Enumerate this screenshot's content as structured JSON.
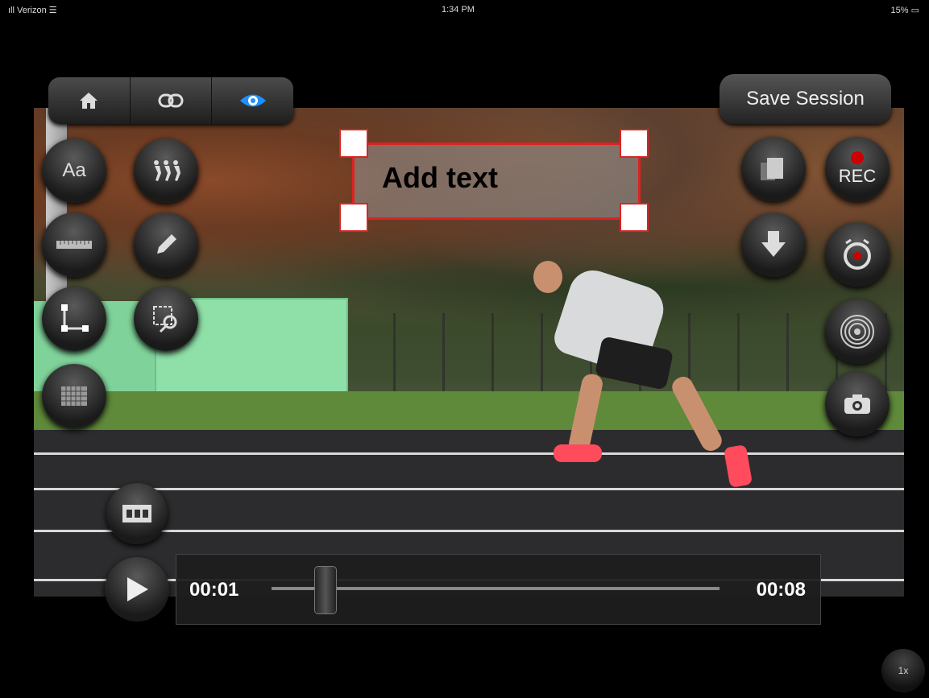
{
  "status_bar": {
    "carrier": "ıll Verizon ☰",
    "time": "1:34 PM",
    "battery": "15% ▭"
  },
  "toolbar": {
    "tabs": [
      {
        "icon": "home-icon"
      },
      {
        "icon": "link-icon"
      },
      {
        "icon": "eye-icon",
        "active": true
      }
    ],
    "save_label": "Save Session"
  },
  "annotation": {
    "text": "Add text"
  },
  "tools_left": [
    {
      "icon": "text-style-icon",
      "glyph": "Aa"
    },
    {
      "icon": "runners-icon",
      "glyph": "→→"
    },
    {
      "icon": "ruler-icon",
      "glyph": "━"
    },
    {
      "icon": "pencil-icon",
      "glyph": "✎"
    },
    {
      "icon": "angle-icon",
      "glyph": "└"
    },
    {
      "icon": "zoom-region-icon",
      "glyph": "⌕"
    },
    {
      "icon": "grid-icon",
      "glyph": "▦"
    }
  ],
  "tools_right": [
    {
      "icon": "layers-icon"
    },
    {
      "icon": "record-button",
      "label": "REC"
    },
    {
      "icon": "download-icon"
    },
    {
      "icon": "timer-icon"
    },
    {
      "icon": "target-icon"
    },
    {
      "icon": "camera-icon"
    }
  ],
  "playback": {
    "current_time": "00:01",
    "end_time": "00:08",
    "position": 0.12
  },
  "speed": "1x",
  "colors": {
    "accent": "#1e90ff",
    "record": "#cc0000",
    "textbox_border": "#dd2222"
  }
}
